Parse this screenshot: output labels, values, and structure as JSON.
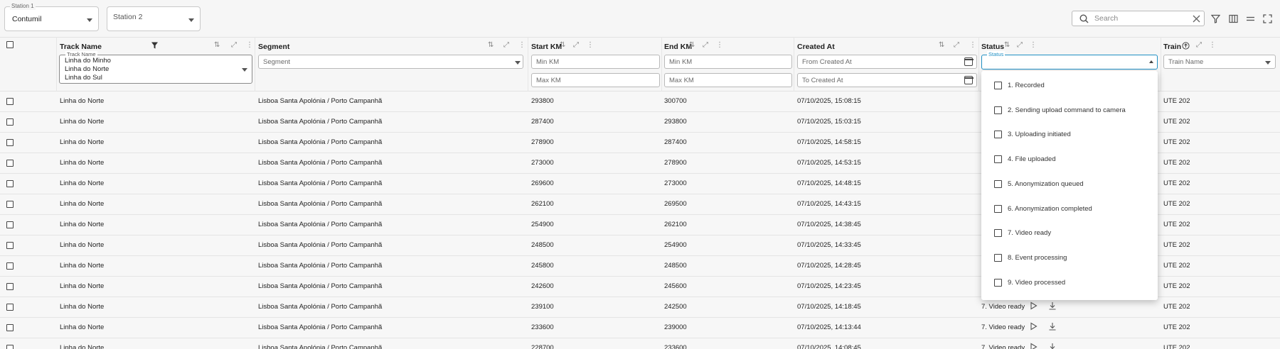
{
  "stations": {
    "station1": {
      "label": "Station 1",
      "value": "Contumil"
    },
    "station2": {
      "placeholder": "Station 2"
    }
  },
  "search": {
    "placeholder": "Search"
  },
  "columns": {
    "track_name": "Track Name",
    "segment": "Segment",
    "start_km": "Start KM",
    "end_km": "End KM",
    "created_at": "Created At",
    "status": "Status",
    "train": "Train"
  },
  "filters": {
    "track_label": "Track Name",
    "track_options": [
      "Linha do Minho",
      "Linha do Norte",
      "Linha do Sul"
    ],
    "segment_placeholder": "Segment",
    "min_km": "Min KM",
    "max_km": "Max KM",
    "end_min_km": "Min KM",
    "end_max_km": "Max KM",
    "from_created": "From Created At",
    "to_created": "To Created At",
    "status_label": "Status",
    "train_placeholder": "Train Name"
  },
  "status_options": [
    "1. Recorded",
    "2. Sending upload command to camera",
    "3. Uploading initiated",
    "4. File uploaded",
    "5. Anonymization queued",
    "6. Anonymization completed",
    "7. Video ready",
    "8. Event processing",
    "9. Video processed"
  ],
  "rows": [
    {
      "track": "Linha do Norte",
      "segment": "Lisboa Santa Apolónia / Porto Campanhã",
      "start": "293800",
      "end": "300700",
      "created": "07/10/2025, 15:08:15",
      "status": "",
      "train": "UTE 202"
    },
    {
      "track": "Linha do Norte",
      "segment": "Lisboa Santa Apolónia / Porto Campanhã",
      "start": "287400",
      "end": "293800",
      "created": "07/10/2025, 15:03:15",
      "status": "",
      "train": "UTE 202"
    },
    {
      "track": "Linha do Norte",
      "segment": "Lisboa Santa Apolónia / Porto Campanhã",
      "start": "278900",
      "end": "287400",
      "created": "07/10/2025, 14:58:15",
      "status": "",
      "train": "UTE 202"
    },
    {
      "track": "Linha do Norte",
      "segment": "Lisboa Santa Apolónia / Porto Campanhã",
      "start": "273000",
      "end": "278900",
      "created": "07/10/2025, 14:53:15",
      "status": "",
      "train": "UTE 202"
    },
    {
      "track": "Linha do Norte",
      "segment": "Lisboa Santa Apolónia / Porto Campanhã",
      "start": "269600",
      "end": "273000",
      "created": "07/10/2025, 14:48:15",
      "status": "",
      "train": "UTE 202"
    },
    {
      "track": "Linha do Norte",
      "segment": "Lisboa Santa Apolónia / Porto Campanhã",
      "start": "262100",
      "end": "269500",
      "created": "07/10/2025, 14:43:15",
      "status": "",
      "train": "UTE 202"
    },
    {
      "track": "Linha do Norte",
      "segment": "Lisboa Santa Apolónia / Porto Campanhã",
      "start": "254900",
      "end": "262100",
      "created": "07/10/2025, 14:38:45",
      "status": "",
      "train": "UTE 202"
    },
    {
      "track": "Linha do Norte",
      "segment": "Lisboa Santa Apolónia / Porto Campanhã",
      "start": "248500",
      "end": "254900",
      "created": "07/10/2025, 14:33:45",
      "status": "",
      "train": "UTE 202"
    },
    {
      "track": "Linha do Norte",
      "segment": "Lisboa Santa Apolónia / Porto Campanhã",
      "start": "245800",
      "end": "248500",
      "created": "07/10/2025, 14:28:45",
      "status": "",
      "train": "UTE 202"
    },
    {
      "track": "Linha do Norte",
      "segment": "Lisboa Santa Apolónia / Porto Campanhã",
      "start": "242600",
      "end": "245600",
      "created": "07/10/2025, 14:23:45",
      "status": "",
      "train": "UTE 202"
    },
    {
      "track": "Linha do Norte",
      "segment": "Lisboa Santa Apolónia / Porto Campanhã",
      "start": "239100",
      "end": "242500",
      "created": "07/10/2025, 14:18:45",
      "status": "7. Video ready",
      "train": "UTE 202"
    },
    {
      "track": "Linha do Norte",
      "segment": "Lisboa Santa Apolónia / Porto Campanhã",
      "start": "233600",
      "end": "239000",
      "created": "07/10/2025, 14:13:44",
      "status": "7. Video ready",
      "train": "UTE 202"
    },
    {
      "track": "Linha do Norte",
      "segment": "Lisboa Santa Apolónia / Porto Campanhã",
      "start": "228700",
      "end": "233600",
      "created": "07/10/2025, 14:08:45",
      "status": "7. Video ready",
      "train": "UTE 202"
    }
  ]
}
